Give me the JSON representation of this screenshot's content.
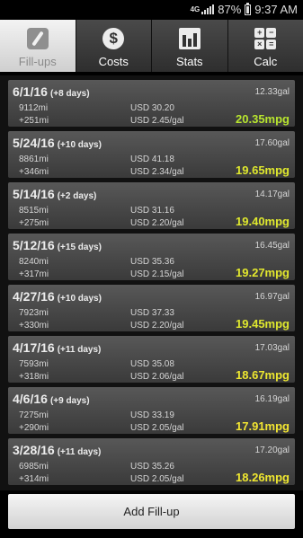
{
  "status_bar": {
    "network": "4G",
    "battery": "87%",
    "time": "9:37 AM"
  },
  "tabs": [
    {
      "label": "Fill-ups",
      "icon": "fuel-pump-icon",
      "active": true
    },
    {
      "label": "Costs",
      "icon": "dollar-icon",
      "active": false
    },
    {
      "label": "Stats",
      "icon": "bar-chart-icon",
      "active": false
    },
    {
      "label": "Calc",
      "icon": "calculator-icon",
      "active": false
    }
  ],
  "fillups": [
    {
      "date": "6/1/16",
      "days": "(+8 days)",
      "gallons": "12.33gal",
      "odometer": "9112mi",
      "distance": "+251mi",
      "cost": "USD 30.20",
      "price": "USD 2.45/gal",
      "mpg": "20.35mpg",
      "mpg_color": "#b8e62e"
    },
    {
      "date": "5/24/16",
      "days": "(+10 days)",
      "gallons": "17.60gal",
      "odometer": "8861mi",
      "distance": "+346mi",
      "cost": "USD 41.18",
      "price": "USD 2.34/gal",
      "mpg": "19.65mpg",
      "mpg_color": "#dfe82e"
    },
    {
      "date": "5/14/16",
      "days": "(+2 days)",
      "gallons": "14.17gal",
      "odometer": "8515mi",
      "distance": "+275mi",
      "cost": "USD 31.16",
      "price": "USD 2.20/gal",
      "mpg": "19.40mpg",
      "mpg_color": "#dfe82e"
    },
    {
      "date": "5/12/16",
      "days": "(+15 days)",
      "gallons": "16.45gal",
      "odometer": "8240mi",
      "distance": "+317mi",
      "cost": "USD 35.36",
      "price": "USD 2.15/gal",
      "mpg": "19.27mpg",
      "mpg_color": "#e3e82e"
    },
    {
      "date": "4/27/16",
      "days": "(+10 days)",
      "gallons": "16.97gal",
      "odometer": "7923mi",
      "distance": "+330mi",
      "cost": "USD 37.33",
      "price": "USD 2.20/gal",
      "mpg": "19.45mpg",
      "mpg_color": "#dfe82e"
    },
    {
      "date": "4/17/16",
      "days": "(+11 days)",
      "gallons": "17.03gal",
      "odometer": "7593mi",
      "distance": "+318mi",
      "cost": "USD 35.08",
      "price": "USD 2.06/gal",
      "mpg": "18.67mpg",
      "mpg_color": "#eee830"
    },
    {
      "date": "4/6/16",
      "days": "(+9 days)",
      "gallons": "16.19gal",
      "odometer": "7275mi",
      "distance": "+290mi",
      "cost": "USD 33.19",
      "price": "USD 2.05/gal",
      "mpg": "17.91mpg",
      "mpg_color": "#f3e632"
    },
    {
      "date": "3/28/16",
      "days": "(+11 days)",
      "gallons": "17.20gal",
      "odometer": "6985mi",
      "distance": "+314mi",
      "cost": "USD 35.26",
      "price": "USD 2.05/gal",
      "mpg": "18.26mpg",
      "mpg_color": "#f0e830"
    }
  ],
  "add_button": {
    "label": "Add Fill-up"
  }
}
